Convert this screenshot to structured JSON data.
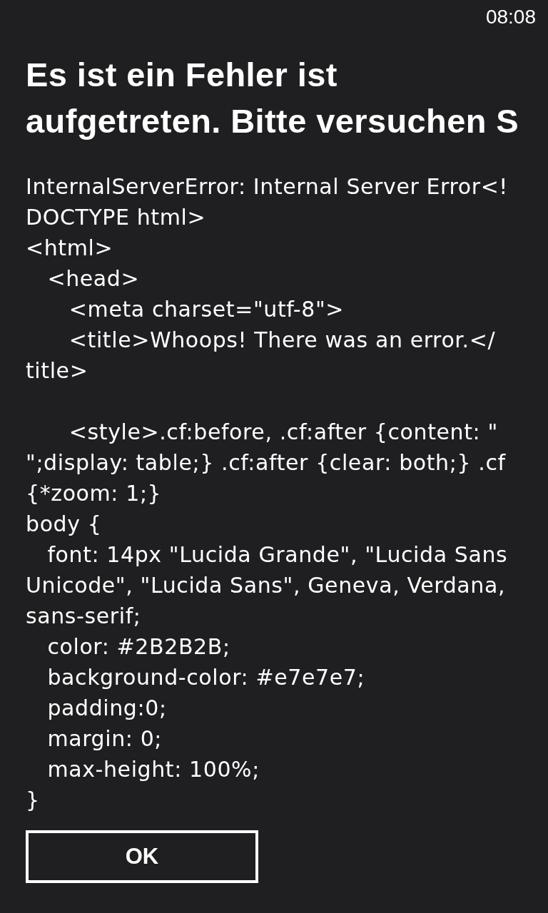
{
  "status_bar": {
    "time": "08:08"
  },
  "dialog": {
    "title_lines": [
      "Es ist ein Fehler ist",
      "aufgetreten. Bitte versuchen S"
    ],
    "message": "InternalServerError: Internal Server Error<!\nDOCTYPE html>\n<html>\n   <head>\n      <meta charset=\"utf-8\">\n      <title>Whoops! There was an error.</\ntitle>\n\n      <style>.cf:before, .cf:after {content: \"\n\";display: table;} .cf:after {clear: both;} .cf\n{*zoom: 1;}\nbody {\n   font: 14px \"Lucida Grande\", \"Lucida Sans\nUnicode\", \"Lucida Sans\", Geneva, Verdana,\nsans-serif;\n   color: #2B2B2B;\n   background-color: #e7e7e7;\n   padding:0;\n   margin: 0;\n   max-height: 100%;\n}",
    "buttons": [
      {
        "label": "OK"
      }
    ]
  }
}
